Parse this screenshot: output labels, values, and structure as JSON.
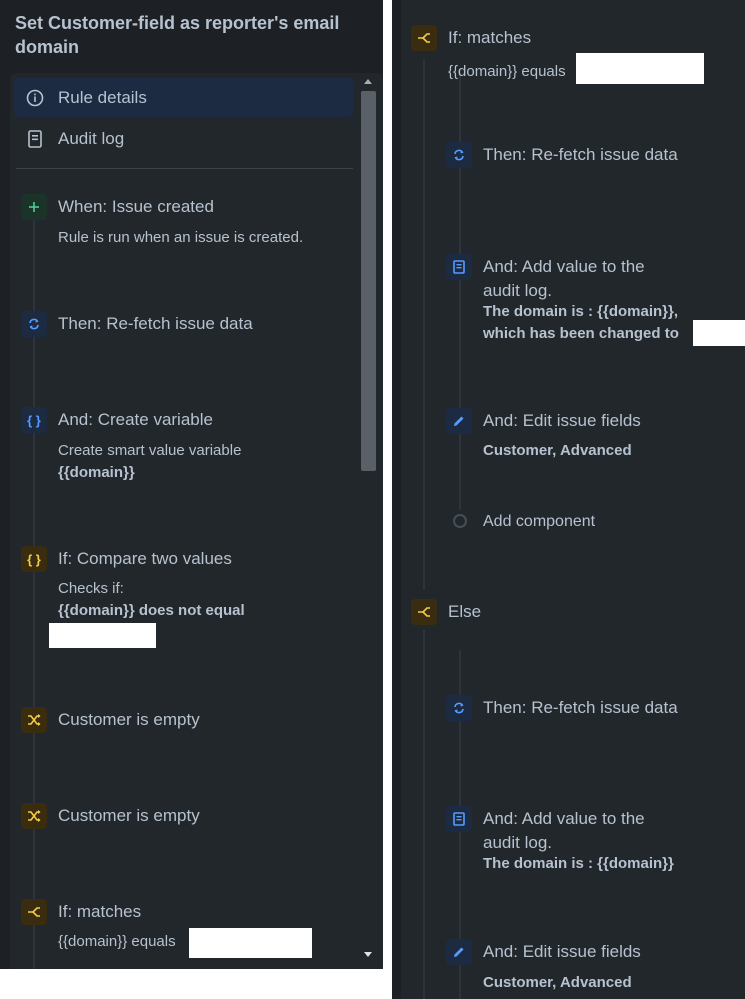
{
  "left": {
    "title": "Set Customer-field as reporter's email domain",
    "nav": [
      {
        "label": "Rule details",
        "icon": "info-icon",
        "selected": true
      },
      {
        "label": "Audit log",
        "icon": "document-icon",
        "selected": false
      }
    ],
    "steps": [
      {
        "title": "When: Issue created",
        "desc": "Rule is run when an issue is created.",
        "icon": "plus-icon"
      },
      {
        "title": "Then: Re-fetch issue data",
        "icon": "refresh-icon"
      },
      {
        "title": "And: Create variable",
        "desc": "Create smart value variable",
        "desc_bold": "{{domain}}",
        "icon": "braces-icon"
      },
      {
        "title": "If: Compare two values",
        "desc": "Checks if:",
        "desc_bold": "{{domain}} does not equal",
        "icon": "braces-icon"
      },
      {
        "title": "Customer is empty",
        "icon": "shuffle-icon"
      },
      {
        "title": "Customer is empty",
        "icon": "shuffle-icon"
      },
      {
        "title": "If: matches",
        "desc": "{{domain}} equals",
        "icon": "branch-icon"
      }
    ]
  },
  "right": {
    "steps": [
      {
        "title": "If: matches",
        "desc": "{{domain}} equals",
        "icon": "branch-icon"
      },
      {
        "title": "Then: Re-fetch issue data",
        "icon": "refresh-icon"
      },
      {
        "title": "And: Add value to the audit log.",
        "desc_bold": "The domain is : {{domain}}, which has been changed to",
        "icon": "document-icon"
      },
      {
        "title": "And: Edit issue fields",
        "desc_bold": "Customer, Advanced",
        "icon": "pencil-icon"
      },
      {
        "title": "Add component",
        "icon": "circle-icon"
      },
      {
        "title": "Else",
        "icon": "branch-icon"
      },
      {
        "title": "Then: Re-fetch issue data",
        "icon": "refresh-icon"
      },
      {
        "title": "And: Add value to the audit log.",
        "desc_bold": "The domain is : {{domain}}",
        "icon": "document-icon"
      },
      {
        "title": "And: Edit issue fields",
        "desc_bold": "Customer, Advanced",
        "icon": "pencil-icon"
      }
    ]
  },
  "colors": {
    "background": "#1d2125",
    "panel": "#22272b",
    "text": "#b6c2cf",
    "accent_blue": "#579dff",
    "accent_green": "#4bce97",
    "accent_yellow": "#f5cd47"
  }
}
